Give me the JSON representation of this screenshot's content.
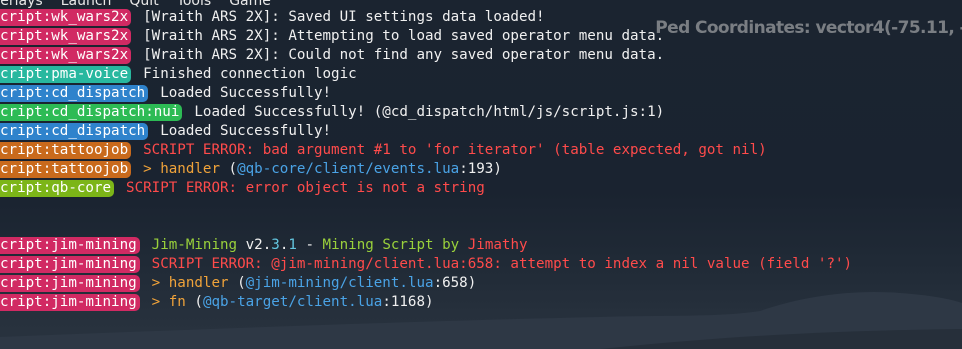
{
  "menu": [
    "verlays",
    "Launch",
    "Quit",
    "Tools",
    "Game"
  ],
  "overlay": {
    "label": "Ped Coordinates: ",
    "value": "vector4(-75.11, -"
  },
  "colors": {
    "magenta": "#d12a63",
    "teal": "#28b89f",
    "blue": "#2f83cc",
    "green": "#2dbb55",
    "orange": "#c96a1c",
    "lime": "#7cb518"
  },
  "lines": [
    {
      "tag": "cript:wk_wars2x",
      "tagColor": "magenta",
      "segs": [
        [
          "white",
          "[Wraith ARS 2X]: Saved UI settings data loaded!"
        ]
      ]
    },
    {
      "tag": "cript:wk_wars2x",
      "tagColor": "magenta",
      "segs": [
        [
          "white",
          "[Wraith ARS 2X]: Attempting to load saved operator menu data."
        ]
      ]
    },
    {
      "tag": "cript:wk_wars2x",
      "tagColor": "magenta",
      "segs": [
        [
          "white",
          "[Wraith ARS 2X]: Could not find any saved operator menu data."
        ]
      ]
    },
    {
      "tag": "cript:pma-voice",
      "tagColor": "teal",
      "segs": [
        [
          "white",
          "Finished connection logic"
        ]
      ]
    },
    {
      "tag": "cript:cd_dispatch",
      "tagColor": "blue",
      "segs": [
        [
          "white",
          "Loaded Successfully!"
        ]
      ]
    },
    {
      "tag": "cript:cd_dispatch:nui",
      "tagColor": "green",
      "segs": [
        [
          "white",
          "Loaded Successfully! (@cd_dispatch/html/js/script.js:1)"
        ]
      ]
    },
    {
      "tag": "cript:cd_dispatch",
      "tagColor": "blue",
      "segs": [
        [
          "white",
          "Loaded Successfully!"
        ]
      ]
    },
    {
      "tag": "cript:tattoojob",
      "tagColor": "orange",
      "segs": [
        [
          "red",
          "SCRIPT ERROR: bad argument #1 to 'for iterator' (table expected, got nil)"
        ]
      ]
    },
    {
      "tag": "cript:tattoojob",
      "tagColor": "orange",
      "segs": [
        [
          "orange",
          "> handler "
        ],
        [
          "white",
          "("
        ],
        [
          "blue",
          "@qb-core/client/events.lua"
        ],
        [
          "white",
          ":193)"
        ]
      ]
    },
    {
      "tag": "cript:qb-core",
      "tagColor": "lime",
      "segs": [
        [
          "red",
          "SCRIPT ERROR: error object is not a string"
        ]
      ]
    },
    {
      "gap": true
    },
    {
      "tag": "cript:jim-mining",
      "tagColor": "magenta",
      "segs": [
        [
          "green",
          "Jim-Mining "
        ],
        [
          "white",
          "v2."
        ],
        [
          "cyan",
          "3"
        ],
        [
          "white",
          "."
        ],
        [
          "cyan",
          "1"
        ],
        [
          "white",
          " - "
        ],
        [
          "green",
          "Mining Script by "
        ],
        [
          "red",
          "Jimathy"
        ]
      ]
    },
    {
      "tag": "cript:jim-mining",
      "tagColor": "magenta",
      "segs": [
        [
          "red",
          "SCRIPT ERROR: @jim-mining/client.lua:658: attempt to index a nil value (field '?')"
        ]
      ]
    },
    {
      "tag": "cript:jim-mining",
      "tagColor": "magenta",
      "segs": [
        [
          "orange",
          "> handler "
        ],
        [
          "white",
          "("
        ],
        [
          "blue",
          "@jim-mining/client.lua"
        ],
        [
          "white",
          ":658)"
        ]
      ]
    },
    {
      "tag": "cript:jim-mining",
      "tagColor": "magenta",
      "segs": [
        [
          "orange",
          "> fn "
        ],
        [
          "white",
          "("
        ],
        [
          "blue",
          "@qb-target/client.lua"
        ],
        [
          "white",
          ":1168)"
        ]
      ]
    }
  ]
}
